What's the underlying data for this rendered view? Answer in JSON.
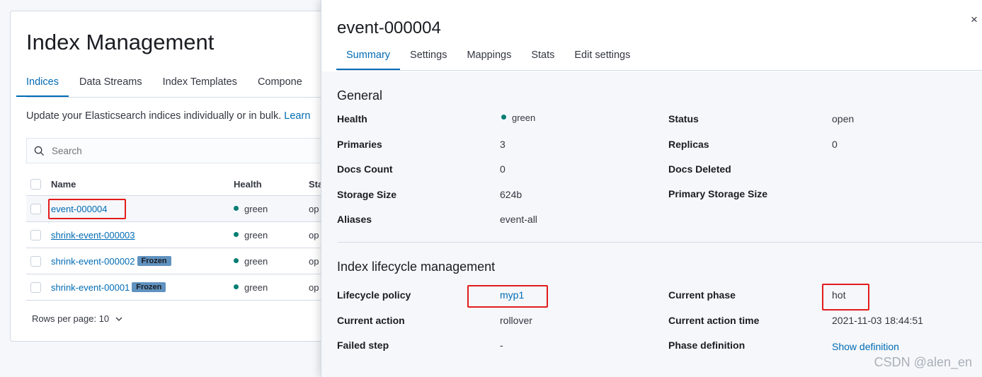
{
  "index_management": {
    "title": "Index Management",
    "tabs": [
      "Indices",
      "Data Streams",
      "Index Templates",
      "Compone"
    ],
    "intro_text": "Update your Elasticsearch indices individually or in bulk.",
    "intro_link": "Learn",
    "search_placeholder": "Search",
    "table": {
      "headers": {
        "name": "Name",
        "health": "Health",
        "status": "Sta"
      },
      "rows": [
        {
          "name": "event-000004",
          "health": "green",
          "status": "op",
          "badge": ""
        },
        {
          "name": "shrink-event-000003",
          "health": "green",
          "status": "op",
          "badge": ""
        },
        {
          "name": "shrink-event-000002",
          "health": "green",
          "status": "op",
          "badge": "Frozen"
        },
        {
          "name": "shrink-event-00001",
          "health": "green",
          "status": "op",
          "badge": "Frozen"
        }
      ]
    },
    "rows_per_page": "Rows per page: 10"
  },
  "flyout": {
    "title": "event-000004",
    "close_icon": "×",
    "tabs": [
      "Summary",
      "Settings",
      "Mappings",
      "Stats",
      "Edit settings"
    ],
    "general": {
      "title": "General",
      "health_label": "Health",
      "health_value": "green",
      "status_label": "Status",
      "status_value": "open",
      "primaries_label": "Primaries",
      "primaries_value": "3",
      "replicas_label": "Replicas",
      "replicas_value": "0",
      "docs_count_label": "Docs Count",
      "docs_count_value": "0",
      "docs_deleted_label": "Docs Deleted",
      "docs_deleted_value": "",
      "storage_size_label": "Storage Size",
      "storage_size_value": "624b",
      "primary_storage_label": "Primary Storage Size",
      "primary_storage_value": "",
      "aliases_label": "Aliases",
      "aliases_value": "event-all"
    },
    "ilm": {
      "title": "Index lifecycle management",
      "policy_label": "Lifecycle policy",
      "policy_value": "myp1",
      "phase_label": "Current phase",
      "phase_value": "hot",
      "action_label": "Current action",
      "action_value": "rollover",
      "action_time_label": "Current action time",
      "action_time_value": "2021-11-03 18:44:51",
      "failed_step_label": "Failed step",
      "failed_step_value": "-",
      "phase_def_label": "Phase definition",
      "phase_def_link": "Show definition"
    }
  },
  "watermark": "CSDN @alen_en",
  "colors": {
    "accent": "#006bb4",
    "health_green": "#017d73",
    "frozen_badge": "#6092c0",
    "highlight_box": "#e31c1c"
  }
}
